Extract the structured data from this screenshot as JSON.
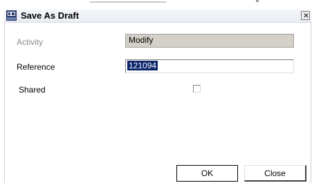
{
  "dialog": {
    "title": "Save As Draft",
    "icon": "rad-app-icon",
    "close_glyph": "×"
  },
  "form": {
    "activity": {
      "label": "Activity",
      "value": "Modify"
    },
    "reference": {
      "label": "Reference",
      "value": "121094"
    },
    "shared": {
      "label": "Shared",
      "checked": false
    }
  },
  "buttons": {
    "ok_label": "OK",
    "close_label": "Close"
  }
}
